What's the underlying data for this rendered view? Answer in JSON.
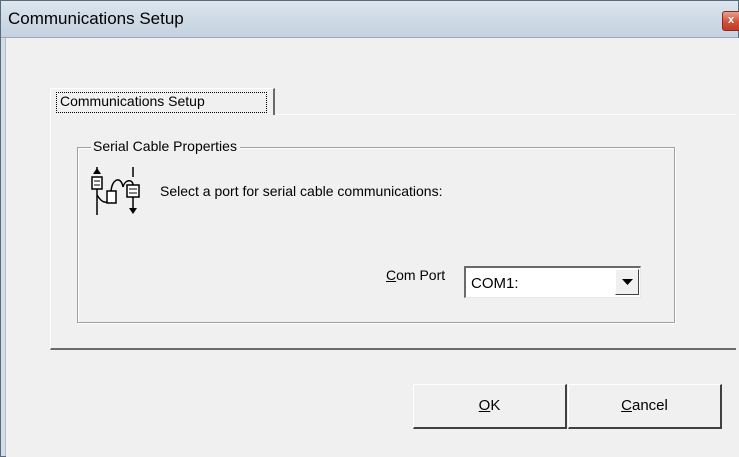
{
  "window": {
    "title": "Communications  Setup",
    "close_glyph": "x"
  },
  "tab": {
    "label": "Communications Setup"
  },
  "group": {
    "label": "Serial Cable Properties",
    "icon": "serial-cable-icon",
    "prompt": "Select a port for serial cable communications:"
  },
  "com_port": {
    "label_mnemonic": "C",
    "label_rest": "om Port",
    "selected": "COM1:"
  },
  "buttons": {
    "ok_mnemonic": "O",
    "ok_rest": "K",
    "cancel_mnemonic": "C",
    "cancel_rest": "ancel"
  }
}
